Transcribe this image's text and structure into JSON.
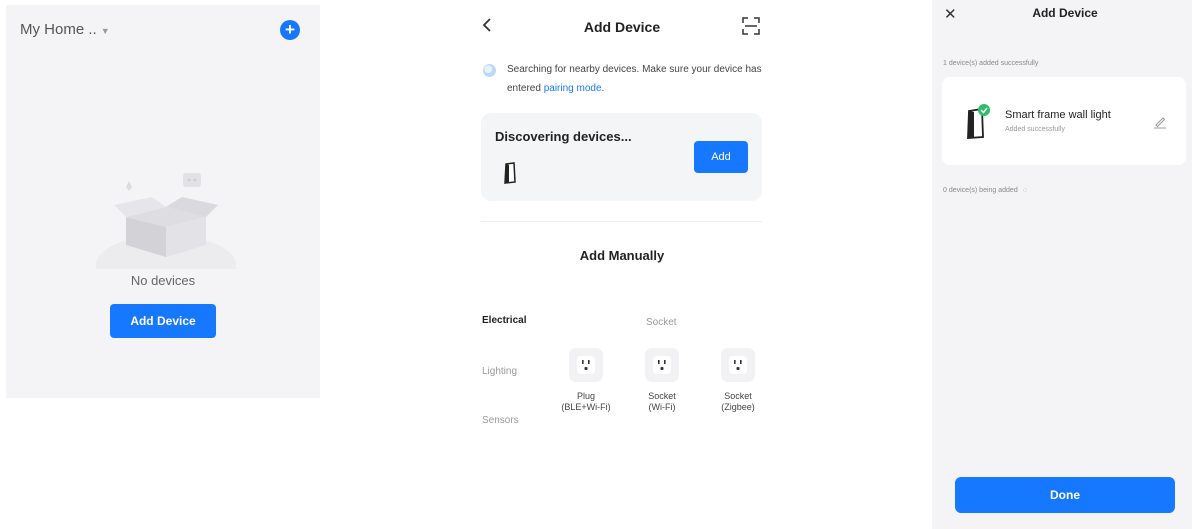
{
  "home": {
    "title": "My Home ..",
    "empty_text": "No devices",
    "add_button": "Add Device",
    "plus_glyph": "+"
  },
  "add_device": {
    "title": "Add Device",
    "searching_text": "Searching for nearby devices. Make sure your device has entered ",
    "pairing_link": "pairing mode",
    "searching_suffix": ".",
    "discovering_title": "Discovering devices...",
    "add_button": "Add",
    "manual_title": "Add Manually",
    "categories": [
      "Electrical",
      "Lighting",
      "Sensors"
    ],
    "subcategory": "Socket",
    "devices": [
      {
        "name": "Plug",
        "sub": "(BLE+Wi-Fi)"
      },
      {
        "name": "Socket",
        "sub": "(Wi-Fi)"
      },
      {
        "name": "Socket",
        "sub": "(Zigbee)"
      }
    ]
  },
  "result": {
    "title": "Add Device",
    "added_label": "1 device(s) added successfully",
    "device_name": "Smart frame wall light",
    "device_status": "Added successfully",
    "adding_label": "0 device(s) being added",
    "done_button": "Done"
  },
  "colors": {
    "accent": "#1677ff",
    "success": "#2bbd6a",
    "panel_bg": "#f4f4f6"
  }
}
